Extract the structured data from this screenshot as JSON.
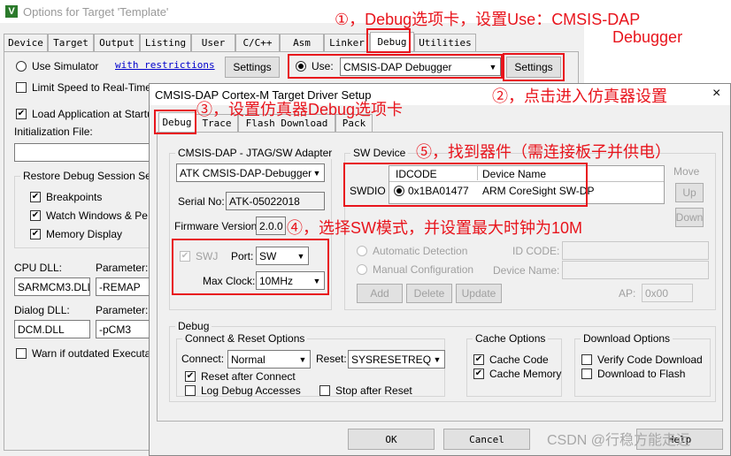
{
  "outer": {
    "title": "Options for Target 'Template'",
    "tabs": [
      "Device",
      "Target",
      "Output",
      "Listing",
      "User",
      "C/C++",
      "Asm",
      "Linker",
      "Debug",
      "Utilities"
    ],
    "use_simulator": "Use Simulator",
    "with_restrictions": "with restrictions",
    "settings": "Settings",
    "use_label": "Use:",
    "debugger_value": "CMSIS-DAP Debugger",
    "limit_speed": "Limit Speed to Real-Time",
    "load_application": "Load Application at Startu",
    "init_file": "Initialization File:",
    "restore_group": "Restore Debug Session Set",
    "breakpoints": "Breakpoints",
    "watch_windows": "Watch Windows & Pe",
    "memory_display": "Memory Display",
    "cpu_dll": "CPU DLL:",
    "parameter": "Parameter:",
    "cpu_dll_value": "SARMCM3.DLL",
    "cpu_param_value": "-REMAP",
    "dialog_dll": "Dialog DLL:",
    "dialog_dll_value": "DCM.DLL",
    "dialog_param_value": "-pCM3",
    "warn_outdated": "Warn if outdated Executab"
  },
  "inner": {
    "title": "CMSIS-DAP Cortex-M Target Driver Setup",
    "close": "×",
    "tabs": [
      "Debug",
      "Trace",
      "Flash Download",
      "Pack"
    ],
    "adapter_group": "CMSIS-DAP - JTAG/SW Adapter",
    "adapter_value": "ATK CMSIS-DAP-Debugger",
    "serial_label": "Serial No:",
    "serial_value": "ATK-05022018",
    "firmware_label": "Firmware Version:",
    "firmware_value": "2.0.0",
    "swj": "SWJ",
    "port_label": "Port:",
    "port_value": "SW",
    "maxclock_label": "Max Clock:",
    "maxclock_value": "10MHz",
    "swdevice_group": "SW Device",
    "col_idcode": "IDCODE",
    "col_device": "Device Name",
    "swdio": "SWDIO",
    "row_idcode": "0x1BA01477",
    "row_device": "ARM CoreSight SW-DP",
    "move": "Move",
    "up": "Up",
    "down": "Down",
    "auto_detect": "Automatic Detection",
    "manual_config": "Manual Configuration",
    "id_code": "ID CODE:",
    "device_name": "Device Name:",
    "add": "Add",
    "delete": "Delete",
    "update": "Update",
    "ap_label": "AP:",
    "ap_value": "0x00",
    "debug_group": "Debug",
    "connect_reset_group": "Connect & Reset Options",
    "connect_label": "Connect:",
    "connect_value": "Normal",
    "reset_label": "Reset:",
    "reset_value": "SYSRESETREQ",
    "reset_after_connect": "Reset after Connect",
    "log_debug": "Log Debug Accesses",
    "stop_after_reset": "Stop after Reset",
    "cache_group": "Cache Options",
    "cache_code": "Cache Code",
    "cache_memory": "Cache Memory",
    "download_group": "Download Options",
    "verify_code": "Verify Code Download",
    "download_flash": "Download to Flash",
    "ok": "OK",
    "cancel": "Cancel",
    "help": "Help"
  },
  "annotations": {
    "a1_line1": "①，Debug选项卡，设置Use：CMSIS-DAP",
    "a1_line2": "Debugger",
    "a2": "②，点击进入仿真器设置",
    "a3": "③，设置仿真器Debug选项卡",
    "a4": "④，选择SW模式，并设置最大时钟为10M",
    "a5": "⑤，找到器件（需连接板子并供电）"
  },
  "watermark": "CSDN @行稳方能走远",
  "colors": {
    "annotation": "#e8141c",
    "link": "#0000cc",
    "window_bg": "#f0f0f0"
  }
}
